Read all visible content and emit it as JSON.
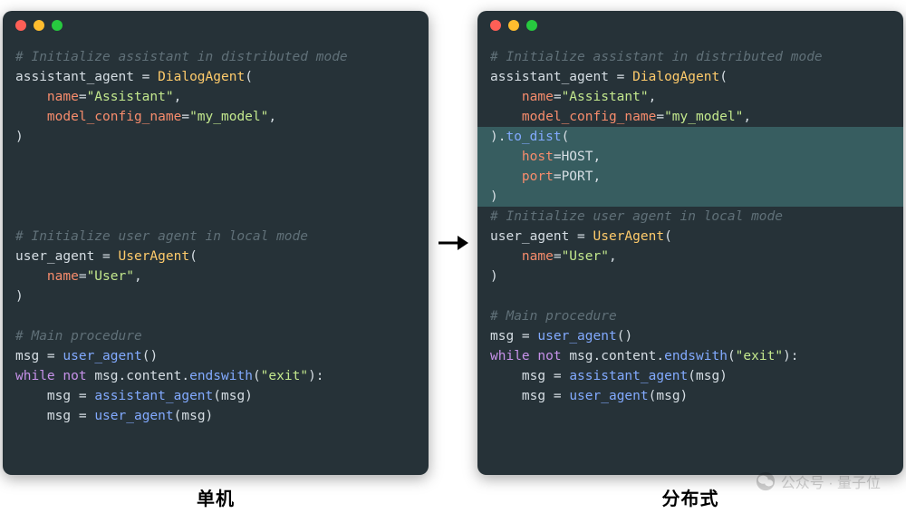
{
  "left": {
    "caption": "单机",
    "lines": [
      {
        "cls": "c-comment",
        "text": "# Initialize assistant in distributed mode"
      },
      {
        "segs": [
          {
            "cls": "c-var",
            "t": "assistant_agent"
          },
          {
            "cls": "c-default",
            "t": " = "
          },
          {
            "cls": "c-class",
            "t": "DialogAgent"
          },
          {
            "cls": "c-default",
            "t": "("
          }
        ]
      },
      {
        "segs": [
          {
            "cls": "c-default",
            "t": "    "
          },
          {
            "cls": "c-param",
            "t": "name"
          },
          {
            "cls": "c-default",
            "t": "="
          },
          {
            "cls": "c-string",
            "t": "\"Assistant\""
          },
          {
            "cls": "c-default",
            "t": ","
          }
        ]
      },
      {
        "segs": [
          {
            "cls": "c-default",
            "t": "    "
          },
          {
            "cls": "c-param",
            "t": "model_config_name"
          },
          {
            "cls": "c-default",
            "t": "="
          },
          {
            "cls": "c-string",
            "t": "\"my_model\""
          },
          {
            "cls": "c-default",
            "t": ","
          }
        ]
      },
      {
        "segs": [
          {
            "cls": "c-default",
            "t": ")"
          }
        ]
      },
      {
        "blank": ". "
      },
      {
        "blank": ". "
      },
      {
        "blank": ". "
      },
      {
        "blank": ". "
      },
      {
        "cls": "c-comment",
        "text": "# Initialize user agent in local mode"
      },
      {
        "segs": [
          {
            "cls": "c-var",
            "t": "user_agent"
          },
          {
            "cls": "c-default",
            "t": " = "
          },
          {
            "cls": "c-class",
            "t": "UserAgent"
          },
          {
            "cls": "c-default",
            "t": "("
          }
        ]
      },
      {
        "segs": [
          {
            "cls": "c-default",
            "t": "    "
          },
          {
            "cls": "c-param",
            "t": "name"
          },
          {
            "cls": "c-default",
            "t": "="
          },
          {
            "cls": "c-string",
            "t": "\"User\""
          },
          {
            "cls": "c-default",
            "t": ","
          }
        ]
      },
      {
        "segs": [
          {
            "cls": "c-default",
            "t": ")"
          }
        ]
      },
      {
        "blank": ". "
      },
      {
        "cls": "c-comment",
        "text": "# Main procedure"
      },
      {
        "segs": [
          {
            "cls": "c-var",
            "t": "msg"
          },
          {
            "cls": "c-default",
            "t": " = "
          },
          {
            "cls": "c-func",
            "t": "user_agent"
          },
          {
            "cls": "c-default",
            "t": "()"
          }
        ]
      },
      {
        "segs": [
          {
            "cls": "c-keyword",
            "t": "while"
          },
          {
            "cls": "c-default",
            "t": " "
          },
          {
            "cls": "c-keyword",
            "t": "not"
          },
          {
            "cls": "c-default",
            "t": " msg.content."
          },
          {
            "cls": "c-func",
            "t": "endswith"
          },
          {
            "cls": "c-default",
            "t": "("
          },
          {
            "cls": "c-string",
            "t": "\"exit\""
          },
          {
            "cls": "c-default",
            "t": "):"
          }
        ]
      },
      {
        "segs": [
          {
            "cls": "c-default",
            "t": "    msg = "
          },
          {
            "cls": "c-func",
            "t": "assistant_agent"
          },
          {
            "cls": "c-default",
            "t": "(msg)"
          }
        ]
      },
      {
        "segs": [
          {
            "cls": "c-default",
            "t": "    msg = "
          },
          {
            "cls": "c-func",
            "t": "user_agent"
          },
          {
            "cls": "c-default",
            "t": "(msg)"
          }
        ]
      }
    ]
  },
  "right": {
    "caption": "分布式",
    "lines": [
      {
        "cls": "c-comment",
        "text": "# Initialize assistant in distributed mode"
      },
      {
        "segs": [
          {
            "cls": "c-var",
            "t": "assistant_agent"
          },
          {
            "cls": "c-default",
            "t": " = "
          },
          {
            "cls": "c-class",
            "t": "DialogAgent"
          },
          {
            "cls": "c-default",
            "t": "("
          }
        ]
      },
      {
        "segs": [
          {
            "cls": "c-default",
            "t": "    "
          },
          {
            "cls": "c-param",
            "t": "name"
          },
          {
            "cls": "c-default",
            "t": "="
          },
          {
            "cls": "c-string",
            "t": "\"Assistant\""
          },
          {
            "cls": "c-default",
            "t": ","
          }
        ]
      },
      {
        "segs": [
          {
            "cls": "c-default",
            "t": "    "
          },
          {
            "cls": "c-param",
            "t": "model_config_name"
          },
          {
            "cls": "c-default",
            "t": "="
          },
          {
            "cls": "c-string",
            "t": "\"my_model\""
          },
          {
            "cls": "c-default",
            "t": ","
          }
        ]
      },
      {
        "hl": true,
        "segs": [
          {
            "cls": "c-default",
            "t": ")."
          },
          {
            "cls": "c-func",
            "t": "to_dist"
          },
          {
            "cls": "c-default",
            "t": "("
          }
        ]
      },
      {
        "hl": true,
        "segs": [
          {
            "cls": "c-default",
            "t": "    "
          },
          {
            "cls": "c-param",
            "t": "host"
          },
          {
            "cls": "c-default",
            "t": "="
          },
          {
            "cls": "c-const",
            "t": "HOST"
          },
          {
            "cls": "c-default",
            "t": ","
          }
        ]
      },
      {
        "hl": true,
        "segs": [
          {
            "cls": "c-default",
            "t": "    "
          },
          {
            "cls": "c-param",
            "t": "port"
          },
          {
            "cls": "c-default",
            "t": "="
          },
          {
            "cls": "c-const",
            "t": "PORT"
          },
          {
            "cls": "c-default",
            "t": ","
          }
        ]
      },
      {
        "hl": true,
        "segs": [
          {
            "cls": "c-default",
            "t": ")"
          }
        ]
      },
      {
        "cls": "c-comment",
        "text": "# Initialize user agent in local mode"
      },
      {
        "segs": [
          {
            "cls": "c-var",
            "t": "user_agent"
          },
          {
            "cls": "c-default",
            "t": " = "
          },
          {
            "cls": "c-class",
            "t": "UserAgent"
          },
          {
            "cls": "c-default",
            "t": "("
          }
        ]
      },
      {
        "segs": [
          {
            "cls": "c-default",
            "t": "    "
          },
          {
            "cls": "c-param",
            "t": "name"
          },
          {
            "cls": "c-default",
            "t": "="
          },
          {
            "cls": "c-string",
            "t": "\"User\""
          },
          {
            "cls": "c-default",
            "t": ","
          }
        ]
      },
      {
        "segs": [
          {
            "cls": "c-default",
            "t": ")"
          }
        ]
      },
      {
        "blank": ". "
      },
      {
        "cls": "c-comment",
        "text": "# Main procedure"
      },
      {
        "segs": [
          {
            "cls": "c-var",
            "t": "msg"
          },
          {
            "cls": "c-default",
            "t": " = "
          },
          {
            "cls": "c-func",
            "t": "user_agent"
          },
          {
            "cls": "c-default",
            "t": "()"
          }
        ]
      },
      {
        "segs": [
          {
            "cls": "c-keyword",
            "t": "while"
          },
          {
            "cls": "c-default",
            "t": " "
          },
          {
            "cls": "c-keyword",
            "t": "not"
          },
          {
            "cls": "c-default",
            "t": " msg.content."
          },
          {
            "cls": "c-func",
            "t": "endswith"
          },
          {
            "cls": "c-default",
            "t": "("
          },
          {
            "cls": "c-string",
            "t": "\"exit\""
          },
          {
            "cls": "c-default",
            "t": "):"
          }
        ]
      },
      {
        "segs": [
          {
            "cls": "c-default",
            "t": "    msg = "
          },
          {
            "cls": "c-func",
            "t": "assistant_agent"
          },
          {
            "cls": "c-default",
            "t": "(msg)"
          }
        ]
      },
      {
        "segs": [
          {
            "cls": "c-default",
            "t": "    msg = "
          },
          {
            "cls": "c-func",
            "t": "user_agent"
          },
          {
            "cls": "c-default",
            "t": "(msg)"
          }
        ]
      }
    ]
  },
  "watermark": "公众号 · 量子位"
}
